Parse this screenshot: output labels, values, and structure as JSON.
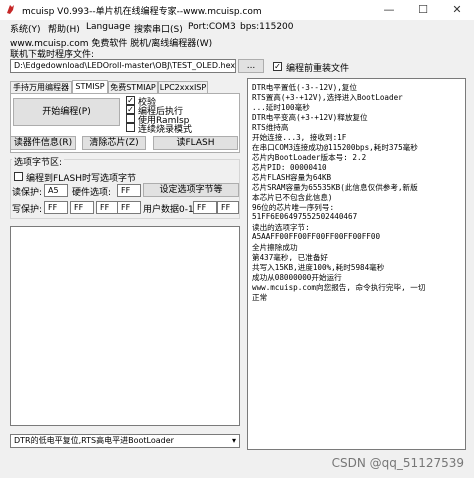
{
  "window": {
    "title": "mcuisp V0.993--单片机在线编程专家--www.mcuisp.com",
    "minimize": "—",
    "maximize": "☐",
    "close": "✕"
  },
  "menu": [
    "系统(Y)",
    "帮助(H)",
    "Language",
    "搜索串口(S)",
    "Port:COM3",
    "bps:115200"
  ],
  "line2": "www.mcuisp.com 免费软件 脱机/离线编程器(W)",
  "file": {
    "label": "联机下载时程序文件:",
    "path": "D:\\Edgedownload\\LEDOroll-master\\OBJ\\TEST_OLED.hex",
    "browse": "...",
    "reload_label": "编程前重装文件",
    "reload_checked": true
  },
  "tabs": [
    "手持万用编程器",
    "STMISP",
    "免费STMIAP",
    "LPC2xxxISP"
  ],
  "tab_active": 1,
  "isp": {
    "start_button": "开始编程(P)",
    "options": [
      {
        "label": "校验",
        "checked": true
      },
      {
        "label": "编程后执行",
        "checked": true
      },
      {
        "label": "使用RamIsp",
        "checked": false
      },
      {
        "label": "连续烧录模式",
        "checked": false
      }
    ],
    "read_info_button": "读器件信息(R)",
    "erase_button": "清除芯片(Z)",
    "read_flash_button": "读FLASH"
  },
  "option_bytes": {
    "group_label": "选项字节区:",
    "write_label": "编程到FLASH时写选项字节",
    "read_protect_label": "读保护:",
    "read_protect_value": "A5",
    "hw_option_label": "硬件选项:",
    "hw_option_value": "FF",
    "set_button": "设定选项字节等",
    "write_protect_label": "写保护:",
    "write_protect_values": [
      "FF",
      "FF",
      "FF",
      "FF"
    ],
    "user_data_label": "用户数据0-1",
    "user_data_values": [
      "FF",
      "FF"
    ]
  },
  "log": [
    "DTR电平置低(-3--12V),复位",
    "RTS置高(+3-+12V),选择进入BootLoader",
    "...延时100毫秒",
    "DTR电平变高(+3-+12V)释放复位",
    "RTS维持高",
    "开始连接...3, 接收到:1F",
    "在串口COM3连接成功@115200bps,耗时375毫秒",
    "芯片内BootLoader版本号: 2.2",
    "芯片PID: 00000410",
    "芯片FLASH容量为64KB",
    "芯片SRAM容量为65535KB(此信息仅供参考,新版",
    "本芯片已不包含此信息)",
    "96位的芯片唯一序列号:",
    "51FF6E06497552502440467",
    "读出的选项字节:",
    "A5AAFF00FF00FF00FF00FF00FF00",
    "全片擦除成功",
    "第437毫秒, 已准备好",
    "共写入15KB,进度100%,耗时5984毫秒",
    "成功从08000000开始运行",
    "www.mcuisp.com向您报告, 命令执行完毕, 一切",
    "正常"
  ],
  "bottom_combo": "DTR的低电平复位,RTS高电平进BootLoader",
  "watermark": "CSDN @qq_51127539"
}
